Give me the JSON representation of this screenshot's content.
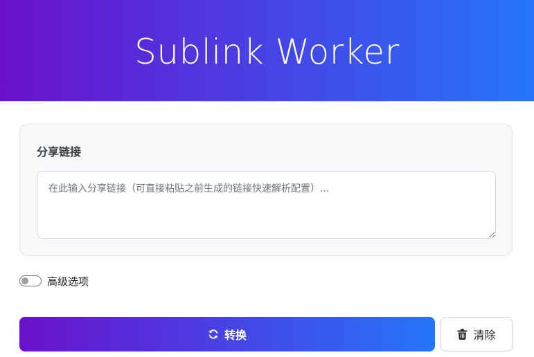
{
  "header": {
    "title": "Sublink Worker",
    "gradient_start": "#6a11cb",
    "gradient_end": "#2575fc"
  },
  "share_card": {
    "label": "分享链接",
    "placeholder": "在此输入分享链接（可直接粘贴之前生成的链接快速解析配置）...",
    "value": ""
  },
  "advanced": {
    "label": "高级选项",
    "enabled": false
  },
  "actions": {
    "convert_label": "转换",
    "convert_icon": "sync-icon",
    "clear_label": "清除",
    "clear_icon": "trash-icon"
  }
}
